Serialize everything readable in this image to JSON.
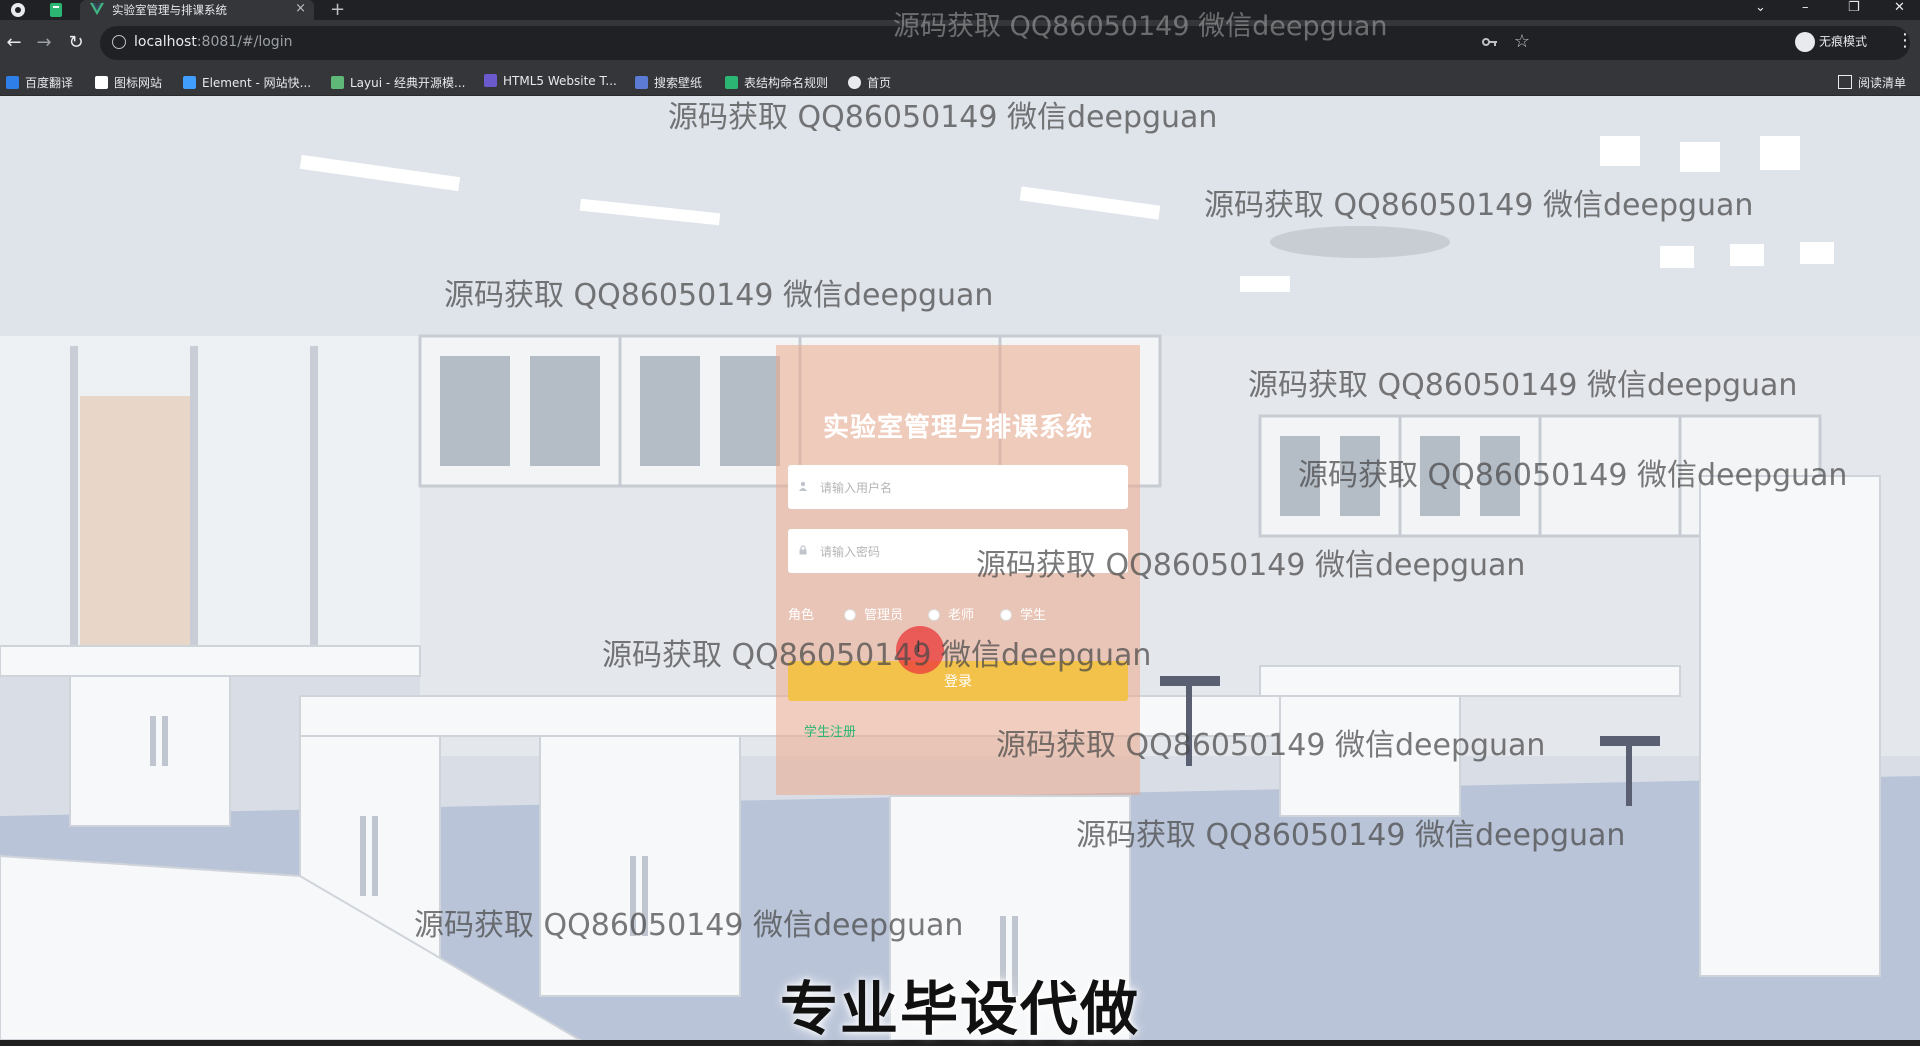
{
  "browser": {
    "tab_title": "实验室管理与排课系统",
    "tab_close": "×",
    "new_tab": "+",
    "url_host": "localhost",
    "url_path": ":8081/#/login",
    "incognito_label": "无痕模式",
    "reading_list": "阅读清单",
    "bookmarks": [
      "百度翻译",
      "图标网站",
      "Element - 网站快...",
      "Layui - 经典开源模...",
      "HTML5 Website T...",
      "搜索壁纸",
      "表结构命名规则",
      "首页"
    ],
    "bookmark_colors": [
      "#2f7fe8",
      "#ffffff",
      "#409eff",
      "#e8eaed",
      "#6a5acd",
      "#5b7bd5",
      "#2bb673",
      "#e8eaed"
    ]
  },
  "login": {
    "title": "实验室管理与排课系统",
    "username_placeholder": "请输入用户名",
    "password_placeholder": "请输入密码",
    "role_label": "角色",
    "roles": [
      "管理员",
      "老师",
      "学生"
    ],
    "login_button": "登录",
    "register_link": "学生注册"
  },
  "watermark": {
    "text": "源码获取 QQ86050149 微信deepguan",
    "banner": "专业毕设代做"
  },
  "colors": {
    "panel": "#eaaa8c",
    "login_button": "#f3c24a",
    "register_link": "#2bb673",
    "cursor_highlight": "#eb3c3c"
  }
}
